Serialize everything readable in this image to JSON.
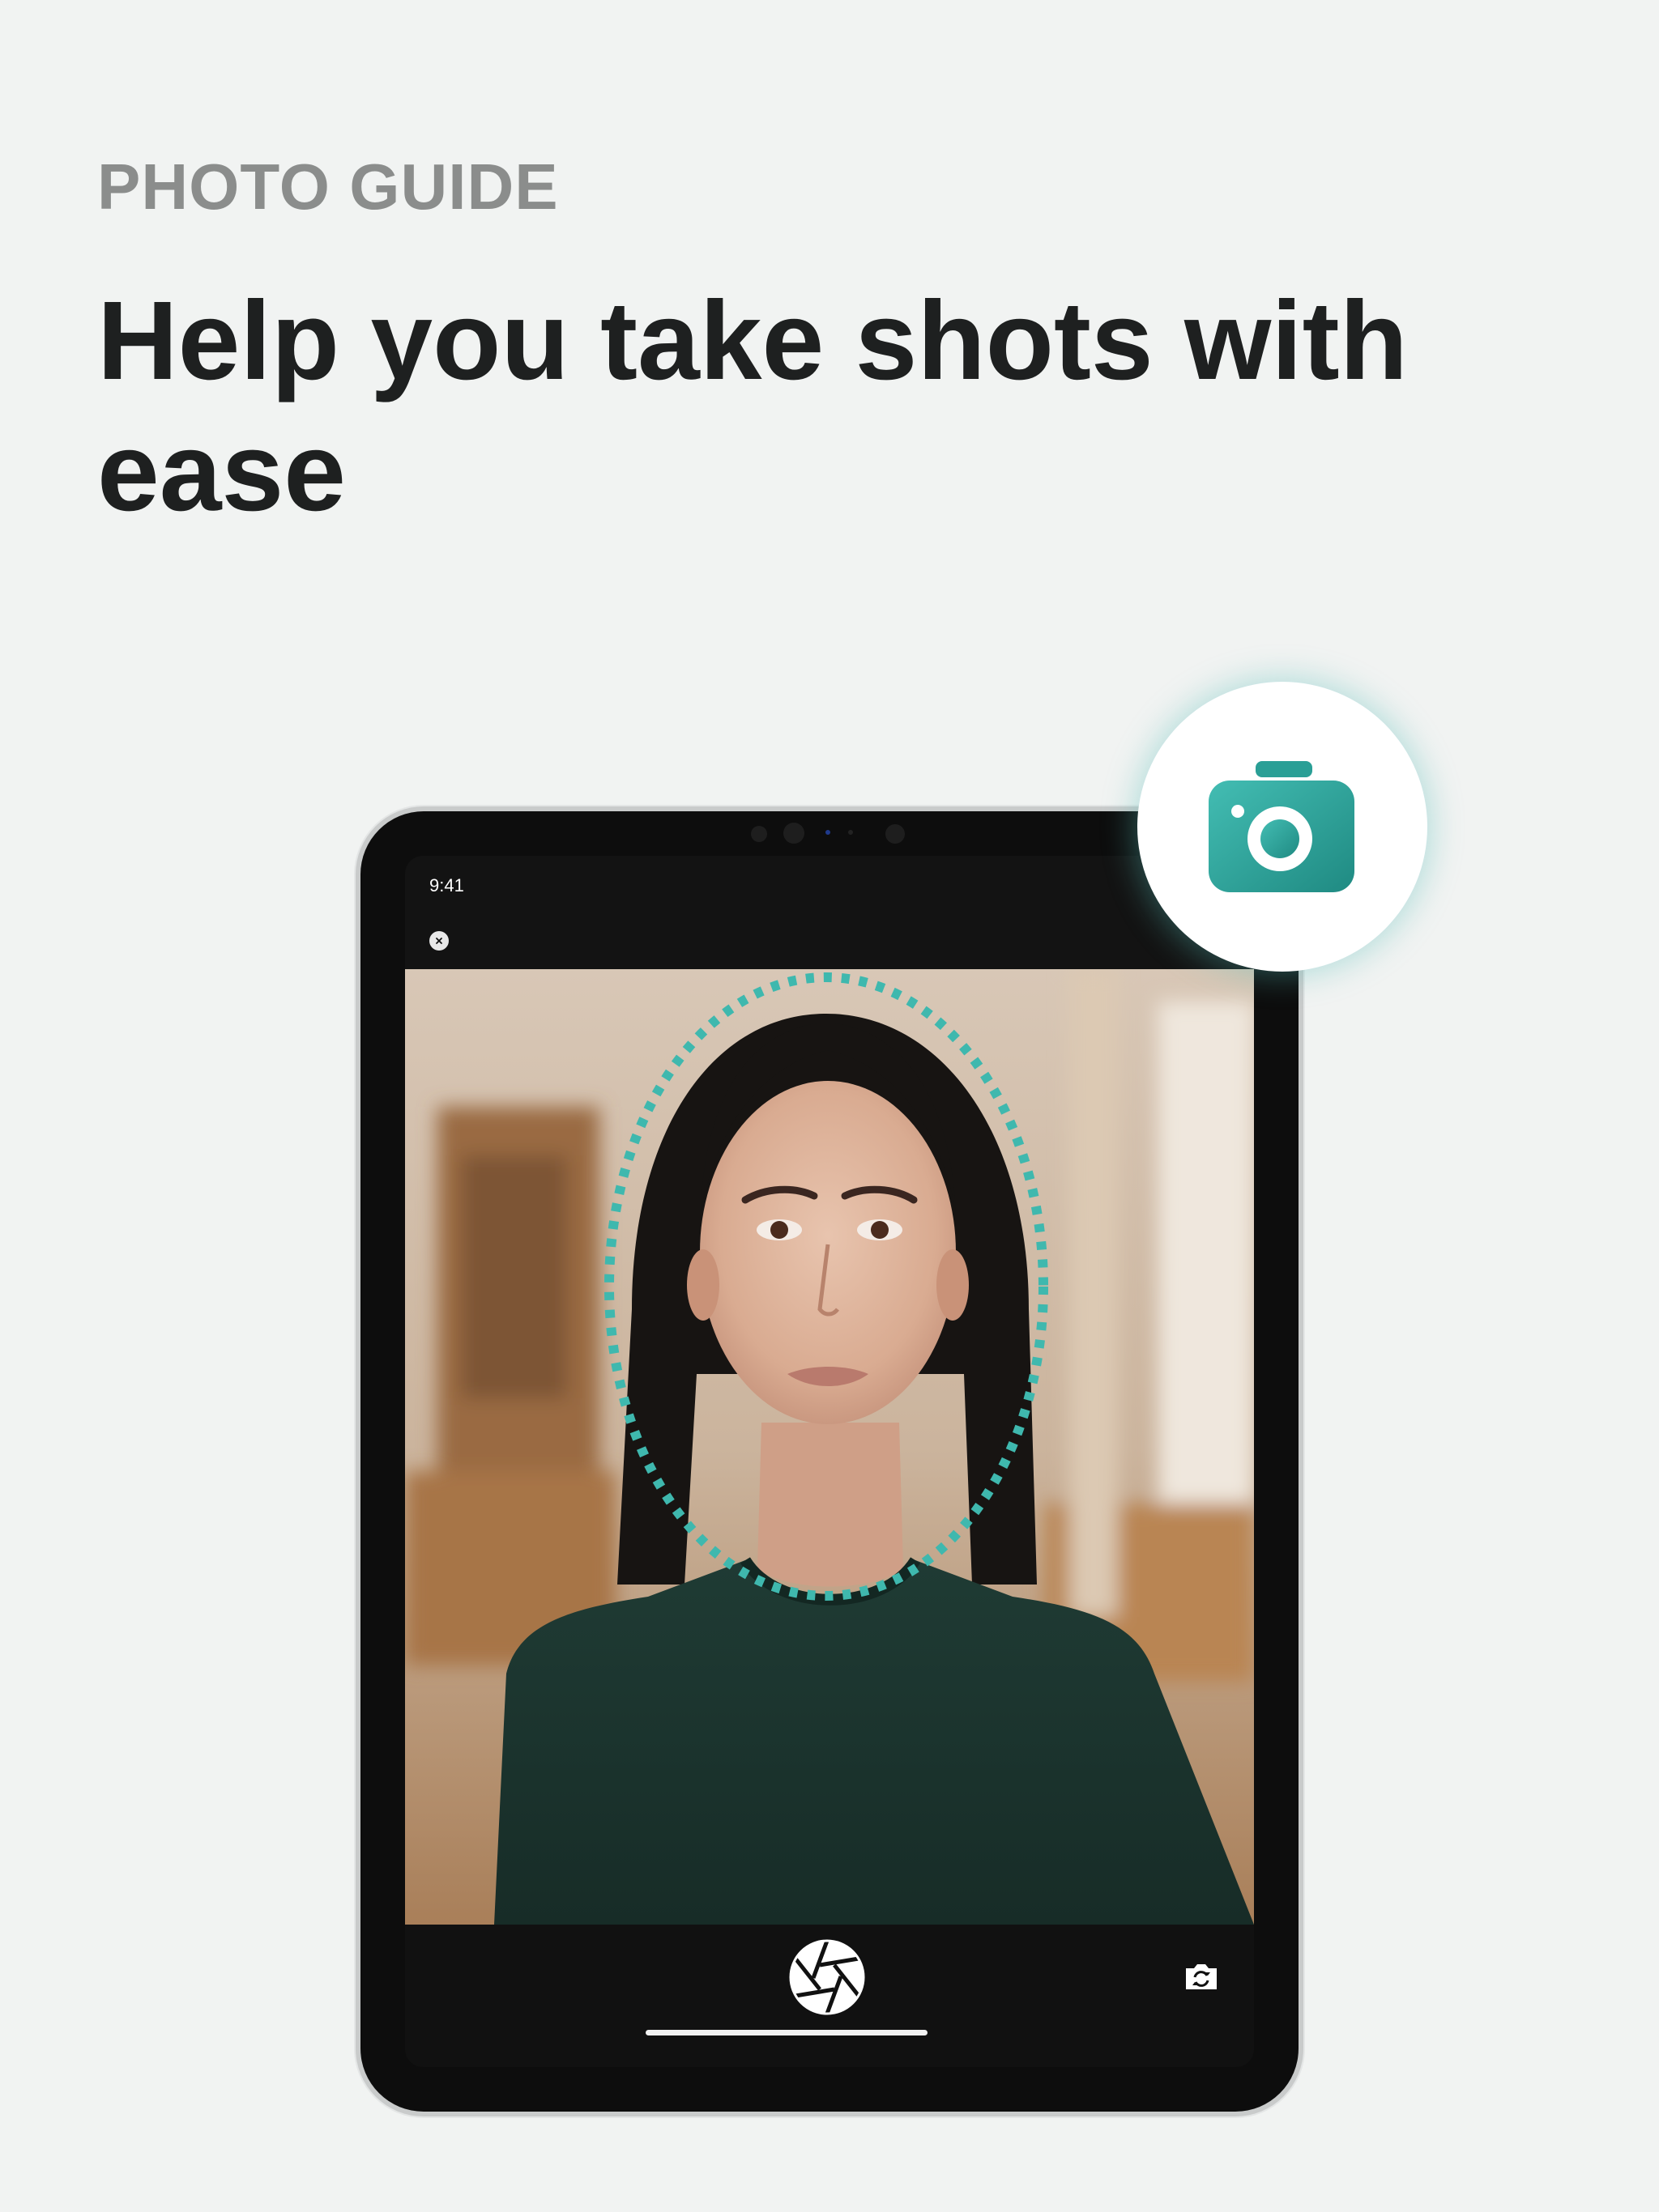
{
  "header": {
    "eyebrow": "PHOTO GUIDE",
    "headline": "Help you take shots with ease"
  },
  "device": {
    "status_time": "9:41"
  },
  "camera": {
    "close_icon": "close-icon",
    "shutter_icon": "aperture-shutter-icon",
    "flip_icon": "flip-camera-icon",
    "face_guide": "dashed oval face guide",
    "guide_color": "#3fb8ae"
  },
  "badge": {
    "icon": "camera-icon",
    "color": "#2a9f96"
  },
  "colors": {
    "background": "#f1f3f2",
    "eyebrow": "#8b8d8c",
    "headline": "#1e2020"
  }
}
